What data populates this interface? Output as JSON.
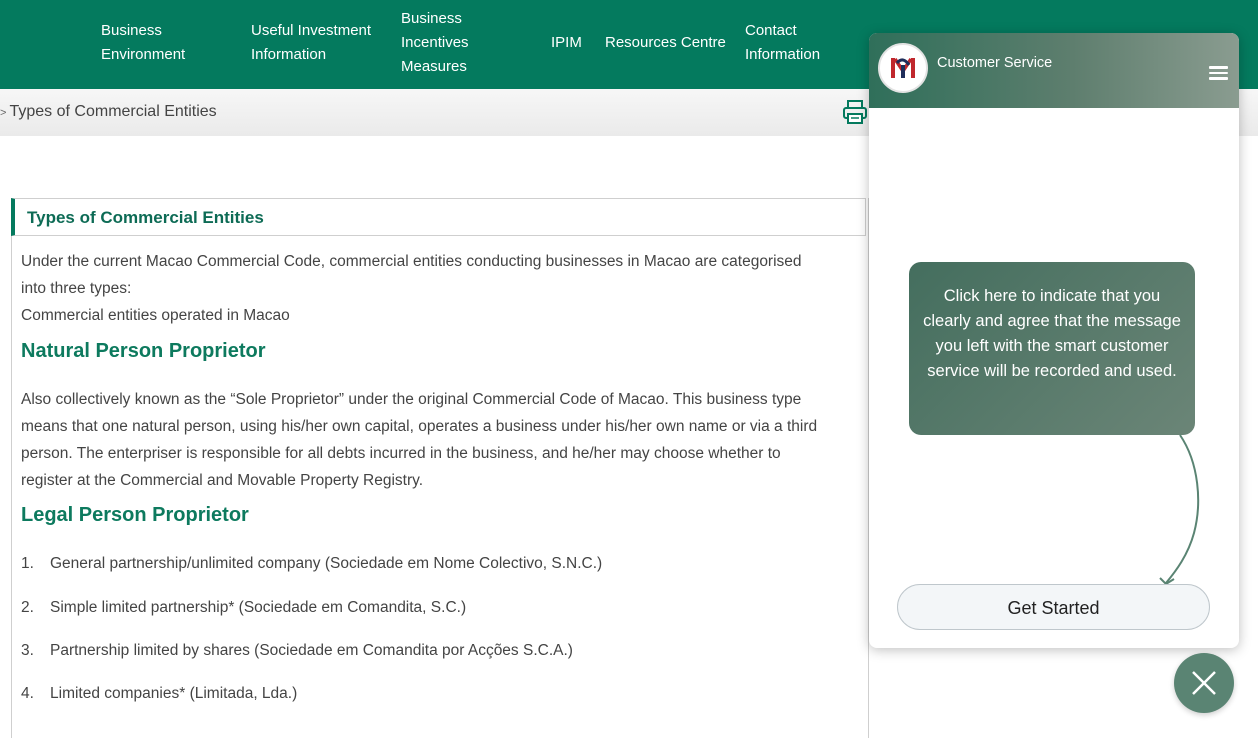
{
  "nav": {
    "items": [
      {
        "label": "Business\nEnvironment"
      },
      {
        "label": "Useful Investment\nInformation"
      },
      {
        "label": "Business\nIncentives\nMeasures"
      },
      {
        "label": "IPIM"
      },
      {
        "label": "Resources Centre"
      },
      {
        "label": "Contact\nInformation"
      }
    ]
  },
  "breadcrumb": {
    "current": "Types of Commercial Entities"
  },
  "article": {
    "section_title": "Types of Commercial Entities",
    "intro_line1": "Under the current Macao Commercial Code, commercial entities conducting businesses in Macao are categorised",
    "intro_line2": "into three types:",
    "intro_line3": "Commercial entities operated in Macao",
    "heading_natural": "Natural Person Proprietor",
    "natural_line1": "Also collectively known as the “Sole Proprietor” under the original Commercial Code of Macao. This business type",
    "natural_line2": "means that one natural person, using his/her own capital, operates a business under his/her own name or via a third",
    "natural_line3": "person. The enterpriser is responsible for all debts incurred in the business, and he/her may choose whether to",
    "natural_line4": "register at the Commercial and Movable Property Registry.",
    "heading_legal": "Legal Person Proprietor",
    "legal_list": [
      {
        "num": "1.",
        "text": "General partnership/unlimited company (Sociedade em Nome Colectivo, S.N.C.)"
      },
      {
        "num": "2.",
        "text": "Simple limited partnership* (Sociedade em Comandita, S.C.)"
      },
      {
        "num": "3.",
        "text": "Partnership limited by shares (Sociedade em Comandita por Acções S.C.A.)"
      },
      {
        "num": "4.",
        "text": "Limited companies* (Limitada, Lda.)"
      }
    ]
  },
  "chat": {
    "title": "Customer Service",
    "bubble_text": "Click here to indicate that you clearly and agree that the message you left with the smart customer service will be recorded and used.",
    "start_label": "Get Started"
  },
  "colors": {
    "brand_green": "#047a5e",
    "heading_green": "#0d7a5e",
    "chat_green": "#5a8473"
  }
}
